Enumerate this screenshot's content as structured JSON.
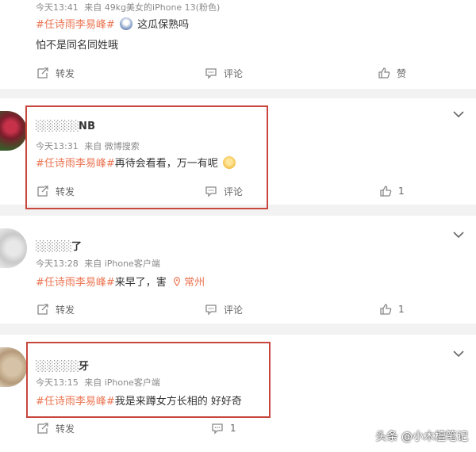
{
  "comments": [
    {
      "time": "今天13:41",
      "source": "来自 49kg美女的iPhone 13(粉色)",
      "hashtag": "#任诗雨李易峰#",
      "text": "这瓜保熟吗",
      "second_line": "怕不是同名同姓哦",
      "repost": "转发",
      "comment": "评论",
      "like": "赞"
    },
    {
      "name": "NB",
      "time": "今天13:31",
      "source": "来自 微博搜索",
      "hashtag": "#任诗雨李易峰#",
      "text": "再待会看看，万一有呢",
      "repost": "转发",
      "comment": "评论",
      "like": "1"
    },
    {
      "name": "了",
      "time": "今天13:28",
      "source": "来自 iPhone客户端",
      "hashtag": "#任诗雨李易峰#",
      "text": "来早了，害",
      "location": "常州",
      "repost": "转发",
      "comment": "评论",
      "like": "1"
    },
    {
      "name": "牙",
      "time": "今天13:15",
      "source": "来自 iPhone客户端",
      "hashtag": "#任诗雨李易峰#",
      "text": "我是来蹲女方长相的 好好奇",
      "repost": "转发",
      "comment": "1",
      "like": ""
    }
  ],
  "watermark": "头条 @小木檀笔记",
  "colors": {
    "hashtag": "#eb7350",
    "highlight": "#c8463c"
  }
}
